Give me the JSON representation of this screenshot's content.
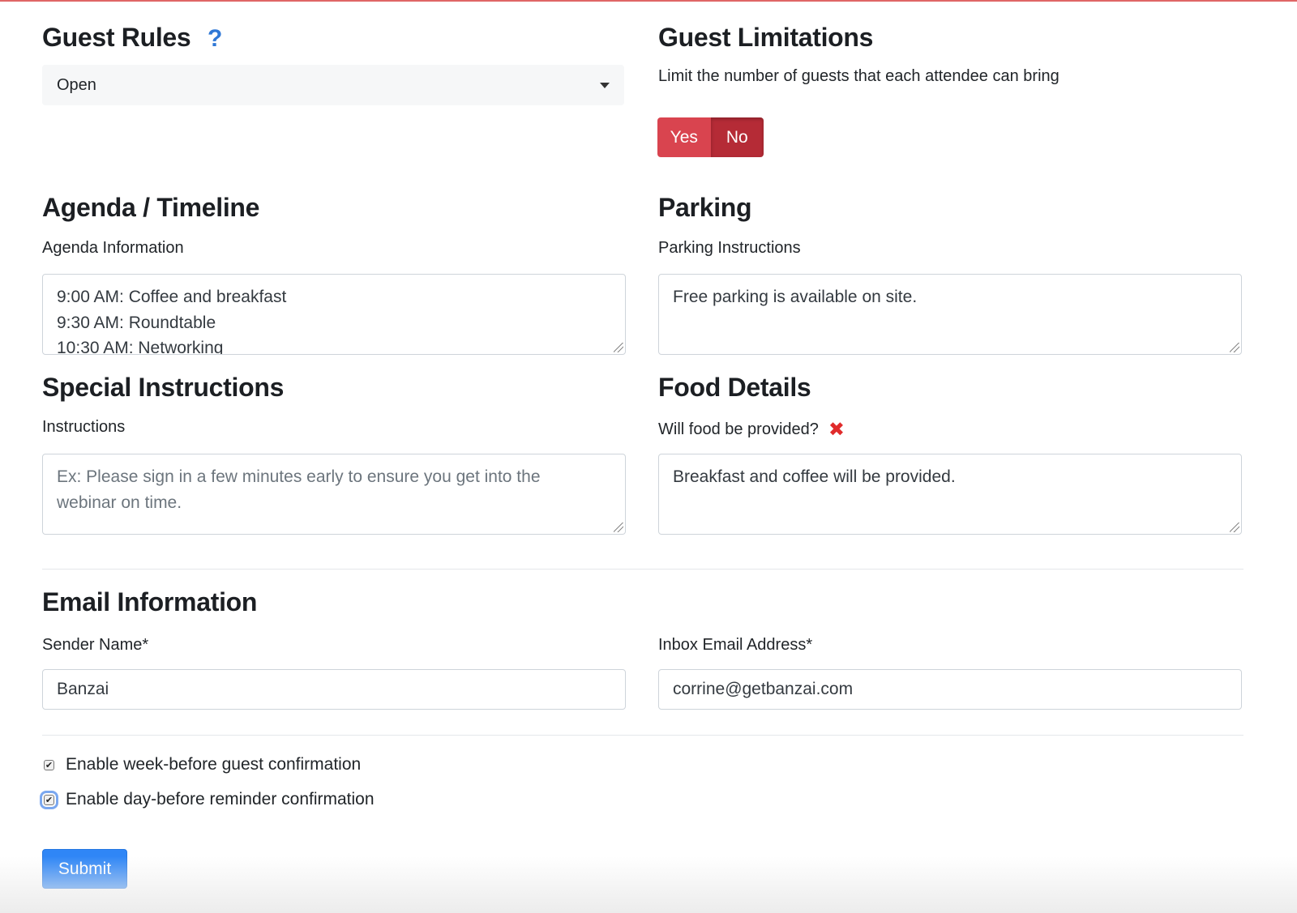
{
  "guest_rules": {
    "title": "Guest Rules",
    "help_icon": "question-mark-icon",
    "select_value": "Open"
  },
  "guest_limitations": {
    "title": "Guest Limitations",
    "description": "Limit the number of guests that each attendee can bring",
    "toggle_yes": "Yes",
    "toggle_no": "No",
    "selected": "No"
  },
  "agenda": {
    "title": "Agenda / Timeline",
    "label": "Agenda Information",
    "lines": [
      "9:00 AM: Coffee and breakfast",
      "9:30 AM: Roundtable",
      "10:30 AM: Networking"
    ]
  },
  "parking": {
    "title": "Parking",
    "label": "Parking Instructions",
    "value": "Free parking is available on site."
  },
  "special_instructions": {
    "title": "Special Instructions",
    "label": "Instructions",
    "placeholder_line1": "Ex: Please sign in a few minutes early to ensure you get into the",
    "placeholder_line2": "webinar on time."
  },
  "food": {
    "title": "Food Details",
    "label": "Will food be provided?",
    "status_icon": "red-x-icon",
    "value": "Breakfast and coffee will be provided."
  },
  "email": {
    "title": "Email Information",
    "sender_label": "Sender Name*",
    "sender_value": "Banzai",
    "inbox_label": "Inbox Email Address*",
    "inbox_value": "corrine@getbanzai.com"
  },
  "checkboxes": [
    {
      "label": "Enable week-before guest confirmation",
      "checked": true
    },
    {
      "label": "Enable day-before reminder confirmation",
      "checked": true
    }
  ],
  "submit_label": "Submit",
  "colors": {
    "accent": "#2f86f6",
    "toggle_red": "#d9444f",
    "toggle_red_active": "#b52b36",
    "help_blue": "#2f78d6",
    "error_red": "#e02b2b"
  }
}
